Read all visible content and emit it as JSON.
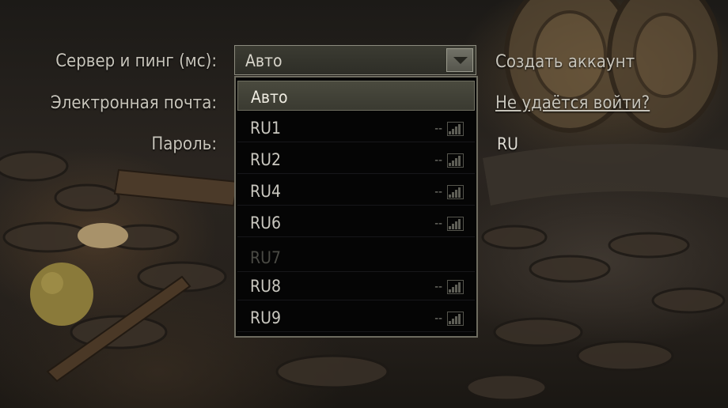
{
  "form": {
    "server_label": "Сервер и пинг (мс):",
    "email_label": "Электронная почта:",
    "password_label": "Пароль:"
  },
  "server_select": {
    "selected": "Авто",
    "options": [
      {
        "name": "Авто",
        "ping": "",
        "state": "active"
      },
      {
        "name": "RU1",
        "ping": "--",
        "state": "normal"
      },
      {
        "name": "RU2",
        "ping": "--",
        "state": "normal"
      },
      {
        "name": "RU4",
        "ping": "--",
        "state": "normal"
      },
      {
        "name": "RU6",
        "ping": "--",
        "state": "normal"
      },
      {
        "name": "RU7",
        "ping": "",
        "state": "disabled"
      },
      {
        "name": "RU8",
        "ping": "--",
        "state": "normal"
      },
      {
        "name": "RU9",
        "ping": "--",
        "state": "normal"
      }
    ]
  },
  "links": {
    "create_account": "Создать аккаунт",
    "cant_login": "Не удаётся войти?"
  },
  "region": "RU",
  "colors": {
    "dropdown_bg": "#050505",
    "active_option": "#44443a",
    "disabled_text": "#4a4a44"
  }
}
